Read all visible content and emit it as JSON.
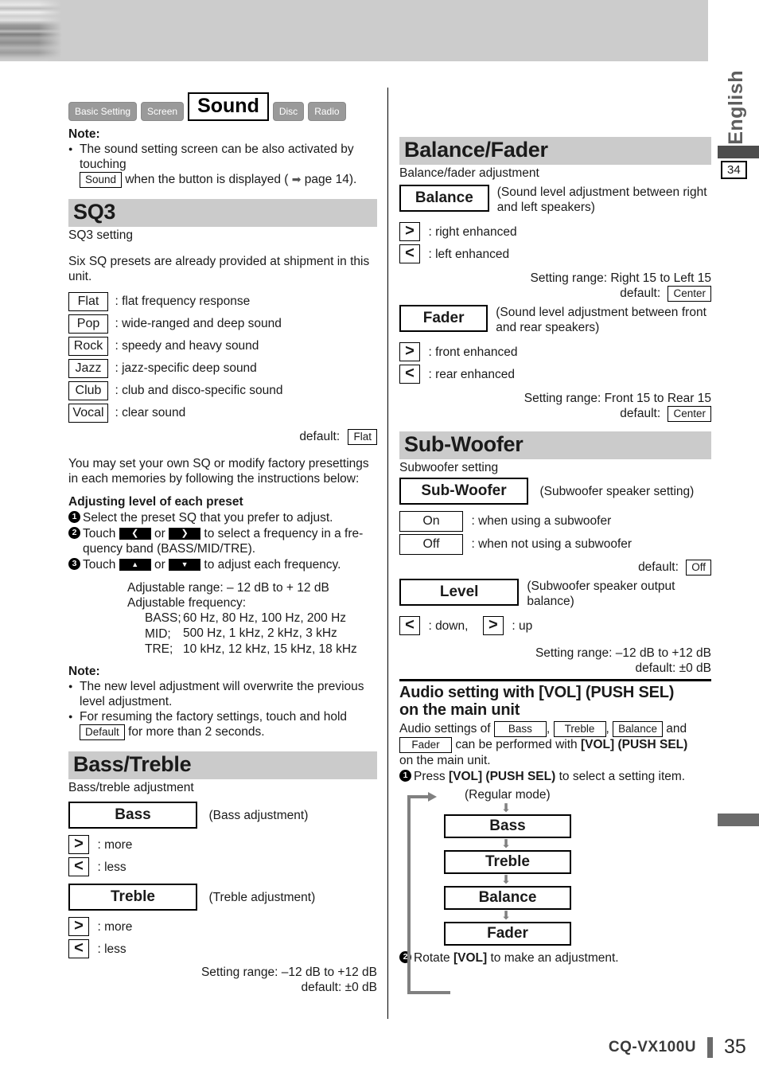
{
  "language_label": "English",
  "page_ref_tab": "34",
  "footer": {
    "model": "CQ-VX100U",
    "page": "35"
  },
  "tabs": [
    {
      "label": "Basic Setting",
      "active": false
    },
    {
      "label": "Screen",
      "active": false
    },
    {
      "label": "Sound",
      "active": true
    },
    {
      "label": "Disc",
      "active": false
    },
    {
      "label": "Radio",
      "active": false
    }
  ],
  "top_note": {
    "title": "Note:",
    "text_before": "The sound setting screen can be also activated by touching",
    "key": "Sound",
    "text_after_1": "when the button is displayed (",
    "arrow": "➡",
    "text_after_2": "page 14)."
  },
  "sq3": {
    "heading": "SQ3",
    "subtitle": "SQ3 setting",
    "intro": "Six SQ presets are already provided at shipment in this unit.",
    "presets": [
      {
        "key": "Flat",
        "desc": ": flat frequency response"
      },
      {
        "key": "Pop",
        "desc": ": wide-ranged and deep sound"
      },
      {
        "key": "Rock",
        "desc": ": speedy and heavy sound"
      },
      {
        "key": "Jazz",
        "desc": ": jazz-specific deep sound"
      },
      {
        "key": "Club",
        "desc": ": club and disco-specific sound"
      },
      {
        "key": "Vocal",
        "desc": ": clear sound"
      }
    ],
    "default_label": "default:",
    "default_value": "Flat",
    "own_sq_text": "You may set your own SQ or modify factory presettings in each memories by following the instructions below:",
    "adjust_title": "Adjusting level of each preset",
    "step1": "Select the preset SQ that you prefer to adjust.",
    "step2_a": "Touch",
    "step2_or": "or",
    "step2_b": "to select a frequency in a fre-",
    "step2_c": "quency band (BASS/MID/TRE).",
    "step3_a": "Touch",
    "step3_b": "to adjust each frequency.",
    "range_line": "Adjustable range: – 12 dB to + 12 dB",
    "freq_line": "Adjustable frequency:",
    "freq_bass_label": "BASS;",
    "freq_bass": "60 Hz, 80 Hz, 100 Hz, 200 Hz",
    "freq_mid_label": "MID;",
    "freq_mid": "500 Hz, 1 kHz, 2 kHz, 3 kHz",
    "freq_tre_label": "TRE;",
    "freq_tre": "10 kHz, 12 kHz, 15 kHz, 18 kHz",
    "note_title": "Note:",
    "note1": "The new level adjustment will overwrite the previous level adjustment.",
    "note2_a": "For resuming the factory settings, touch and hold",
    "note2_key": "Default",
    "note2_b": "for more than 2 seconds."
  },
  "bass_treble": {
    "heading": "Bass/Treble",
    "subtitle": "Bass/treble adjustment",
    "bass_button": "Bass",
    "bass_caption": "(Bass adjustment)",
    "bass_more": ": more",
    "bass_less": ": less",
    "treble_button": "Treble",
    "treble_caption": "(Treble adjustment)",
    "treble_more": ": more",
    "treble_less": ": less",
    "range": "Setting range: –12 dB to +12 dB",
    "default": "default: ±0 dB"
  },
  "balance_fader": {
    "heading": "Balance/Fader",
    "subtitle": "Balance/fader adjustment",
    "balance_button": "Balance",
    "balance_caption_1": "(Sound level adjustment",
    "balance_caption_2": "between right and left speakers)",
    "balance_right": ": right enhanced",
    "balance_left": ": left enhanced",
    "balance_range": "Setting range: Right 15 to Left 15",
    "balance_default_label": "default:",
    "balance_default_value": "Center",
    "fader_button": "Fader",
    "fader_caption_1": "(Sound level adjustment between",
    "fader_caption_2": "front and rear speakers)",
    "fader_front": ": front enhanced",
    "fader_rear": ": rear enhanced",
    "fader_range": "Setting range: Front 15 to Rear 15",
    "fader_default_label": "default:",
    "fader_default_value": "Center"
  },
  "subwoofer": {
    "heading": "Sub-Woofer",
    "subtitle": "Subwoofer setting",
    "sw_button": "Sub-Woofer",
    "sw_caption": "(Subwoofer speaker setting)",
    "on_key": "On",
    "on_desc": ": when using a subwoofer",
    "off_key": "Off",
    "off_desc": ": when not using a subwoofer",
    "default_label": "default:",
    "default_value": "Off",
    "level_button": "Level",
    "level_caption_1": "(Subwoofer speaker output",
    "level_caption_2": "balance)",
    "level_down": ": down,",
    "level_up": ": up",
    "level_range": "Setting range: –12 dB to +12 dB",
    "level_default": "default: ±0 dB"
  },
  "audio_vol": {
    "title_line1": "Audio setting with [VOL] (PUSH SEL)",
    "title_line2": "on the main unit",
    "intro_a": "Audio settings of",
    "key_bass": "Bass",
    "key_treble": "Treble",
    "key_balance": "Balance",
    "intro_and": "and",
    "key_fader": "Fader",
    "intro_b": "can be performed with",
    "intro_bold": "[VOL] (PUSH SEL)",
    "intro_c": "on the main unit.",
    "step1_a": "Press",
    "step1_bold": "[VOL] (PUSH SEL)",
    "step1_b": "to select a setting item.",
    "regular_mode": "(Regular mode)",
    "flow": [
      "Bass",
      "Treble",
      "Balance",
      "Fader"
    ],
    "step2_a": "Rotate",
    "step2_bold": "[VOL]",
    "step2_b": "to make an adjustment."
  },
  "icons": {
    "chevron_right": "›",
    "chevron_left": "‹",
    "gt": ">",
    "lt": "<",
    "touch_left": "❮",
    "touch_right": "❯",
    "touch_up": "▲",
    "touch_down": "▼",
    "down_arrow": "⬇"
  },
  "colors": {
    "section_bar": "#cbcbcb",
    "tab_inactive": "#9a9a9a",
    "banner": "#cccccc",
    "margin_mark": "#4d4d4d"
  }
}
